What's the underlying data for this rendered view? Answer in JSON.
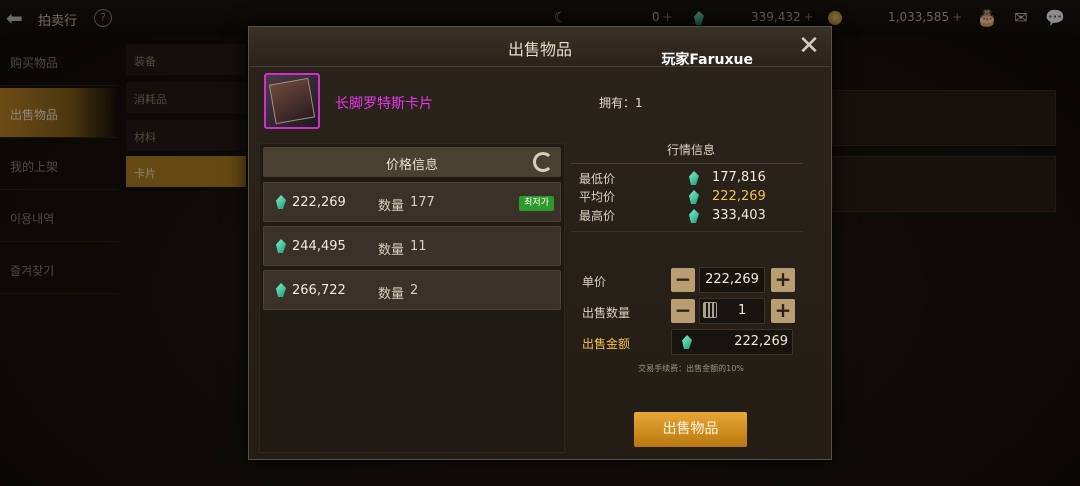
{
  "topbar": {
    "title": "拍卖行",
    "help": "?",
    "val_a": "0",
    "val_b": "339,432",
    "val_c": "1,033,585",
    "plus": "+"
  },
  "leftnav": {
    "items": [
      {
        "label": "购买物品"
      },
      {
        "label": "出售物品"
      },
      {
        "label": "我的上架"
      },
      {
        "label": "이용내역"
      },
      {
        "label": "즐겨찾기"
      }
    ]
  },
  "subnav": {
    "items": [
      {
        "label": "装备"
      },
      {
        "label": "消耗品"
      },
      {
        "label": "材料"
      },
      {
        "label": "卡片"
      }
    ]
  },
  "modal": {
    "title": "出售物品",
    "player": "玩家Faruxue",
    "close": "✕",
    "item_name": "长脚罗特斯卡片",
    "own": "拥有：1",
    "price_info": {
      "title": "价格信息",
      "qty_label": "数量",
      "lowest_badge": "최저가",
      "rows": [
        {
          "price": "222,269",
          "qty": "177"
        },
        {
          "price": "244,495",
          "qty": "11"
        },
        {
          "price": "266,722",
          "qty": "2"
        }
      ]
    },
    "market": {
      "title": "行情信息",
      "min_label": "最低价",
      "min": "177,816",
      "avg_label": "平均价",
      "avg": "222,269",
      "max_label": "最高价",
      "max": "333,403"
    },
    "form": {
      "unit_label": "单价",
      "unit_value": "222,269",
      "qty_label": "出售数量",
      "qty_value": "1",
      "total_label": "出售金额",
      "total_value": "222,269",
      "minus": "−",
      "plus": "+",
      "fee": "交易手续费：出售金额的10%"
    },
    "sell_button": "出售物品"
  }
}
